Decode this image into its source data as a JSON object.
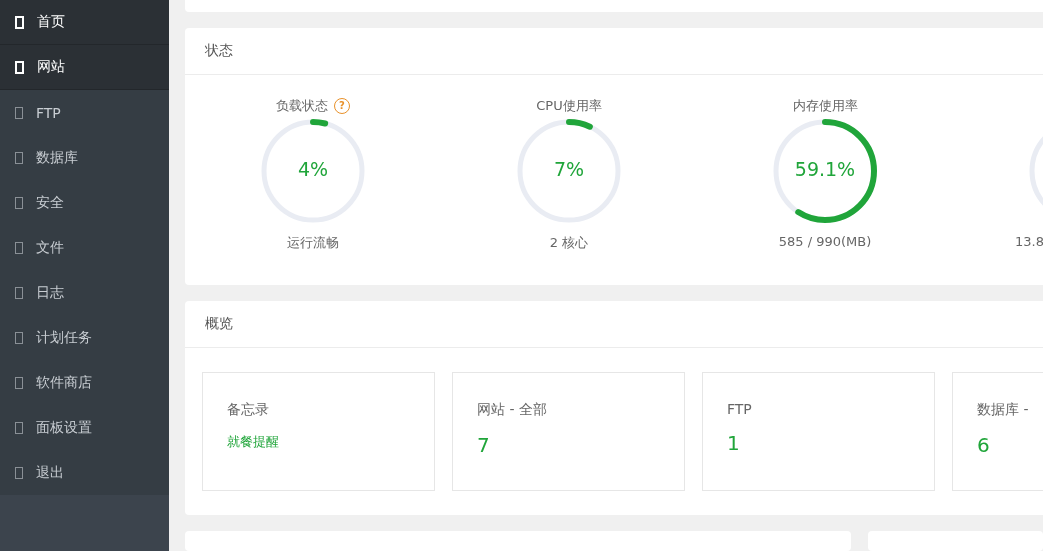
{
  "sidebar": {
    "items": [
      {
        "label": "首页",
        "selected": true
      },
      {
        "label": "网站",
        "selected": true
      },
      {
        "label": "FTP",
        "selected": false
      },
      {
        "label": "数据库",
        "selected": false
      },
      {
        "label": "安全",
        "selected": false
      },
      {
        "label": "文件",
        "selected": false
      },
      {
        "label": "日志",
        "selected": false
      },
      {
        "label": "计划任务",
        "selected": false
      },
      {
        "label": "软件商店",
        "selected": false
      },
      {
        "label": "面板设置",
        "selected": false
      },
      {
        "label": "退出",
        "selected": false
      }
    ]
  },
  "status": {
    "title": "状态",
    "gauges": [
      {
        "title": "负载状态",
        "help": "?",
        "value": "4%",
        "level": 0.04,
        "caption": "运行流畅"
      },
      {
        "title": "CPU使用率",
        "value": "7%",
        "level": 0.07,
        "caption": "2 核心"
      },
      {
        "title": "内存使用率",
        "value": "59.1%",
        "level": 0.591,
        "caption": "585 / 990(MB)"
      },
      {
        "caption": "13.8"
      }
    ]
  },
  "overview": {
    "title": "概览",
    "cards": [
      {
        "label": "备忘录",
        "value": "就餐提醒",
        "kind": "link"
      },
      {
        "label": "网站 - 全部",
        "value": "7",
        "kind": "count"
      },
      {
        "label": "FTP",
        "value": "1",
        "kind": "count"
      },
      {
        "label": "数据库 -",
        "value": "6",
        "kind": "count"
      }
    ]
  }
}
